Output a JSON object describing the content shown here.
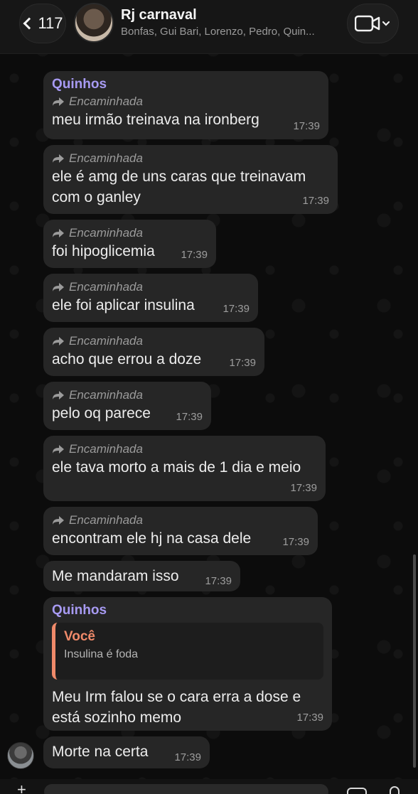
{
  "header": {
    "back_count": "117",
    "title": "Rj carnaval",
    "subtitle": "Bonfas, Gui Bari, Lorenzo, Pedro, Quin..."
  },
  "forwarded_label": "Encaminhada",
  "messages": [
    {
      "sender": "Quinhos",
      "forwarded": true,
      "text": "meu irmão treinava na ironberg",
      "time": "17:39"
    },
    {
      "forwarded": true,
      "text": "ele é amg de uns caras que treinavam com o ganley",
      "time": "17:39"
    },
    {
      "forwarded": true,
      "text": "foi hipoglicemia",
      "time": "17:39"
    },
    {
      "forwarded": true,
      "text": "ele foi aplicar insulina",
      "time": "17:39"
    },
    {
      "forwarded": true,
      "text": "acho que errou a doze",
      "time": "17:39"
    },
    {
      "forwarded": true,
      "text": "pelo oq parece",
      "time": "17:39"
    },
    {
      "forwarded": true,
      "text": "ele tava morto a mais de 1 dia e meio",
      "time": "17:39"
    },
    {
      "forwarded": true,
      "text": "encontram ele hj na casa dele",
      "time": "17:39"
    },
    {
      "forwarded": false,
      "text": "Me mandaram isso",
      "time": "17:39"
    },
    {
      "sender": "Quinhos",
      "reply_to": {
        "sender": "Você",
        "text": "Insulina é foda"
      },
      "text": "Meu Irm falou se o cara erra a dose e está sozinho memo",
      "time": "17:39"
    },
    {
      "forwarded": false,
      "text": "Morte na certa",
      "time": "17:39"
    }
  ],
  "colors": {
    "sender_name": "#a79af2",
    "reply_accent": "#f08a6a",
    "bubble": "#262626",
    "background": "#0c0c0c"
  },
  "icons": [
    "chevron-left-icon",
    "video-camera-icon",
    "chevron-down-icon",
    "forward-arrow-icon",
    "plus-icon",
    "camera-icon",
    "microphone-icon"
  ]
}
